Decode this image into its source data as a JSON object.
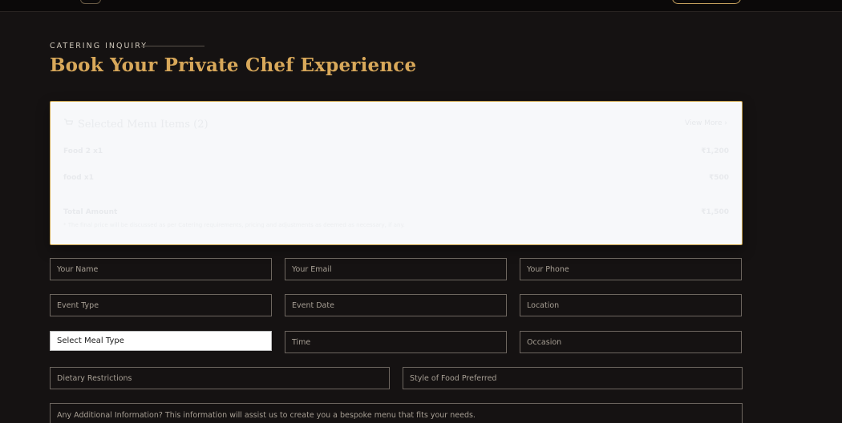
{
  "header": {
    "eyebrow": "CATERING INQUIRY",
    "title": "Book Your Private Chef Experience"
  },
  "cart": {
    "title": "Selected Menu Items (2)",
    "view_more": "View More ›",
    "items": [
      {
        "name": "Food 2 x1",
        "price": "₹1,200"
      },
      {
        "name": "food x1",
        "price": "₹500"
      }
    ],
    "total_label": "Total Amount",
    "total_value": "₹1,500",
    "note": "* The final price will be discussed as per Catering requirements, pricing and adjustments as deemed as necessary, if any."
  },
  "form": {
    "name_placeholder": "Your Name",
    "email_placeholder": "Your Email",
    "phone_placeholder": "Your Phone",
    "event_type_placeholder": "Event Type",
    "event_date_placeholder": "Event Date",
    "location_placeholder": "Location",
    "meal_type_value": "Select Meal Type",
    "time_placeholder": "Time",
    "occasion_placeholder": "Occasion",
    "dietary_placeholder": "Dietary Restrictions",
    "food_style_placeholder": "Style of Food Preferred",
    "additional_info_placeholder": "Any Additional Information? This information will assist us to create you a bespoke menu that fits your needs."
  },
  "colors": {
    "accent": "#d8a85a",
    "background": "#151212",
    "cart_border": "#caa34d"
  }
}
